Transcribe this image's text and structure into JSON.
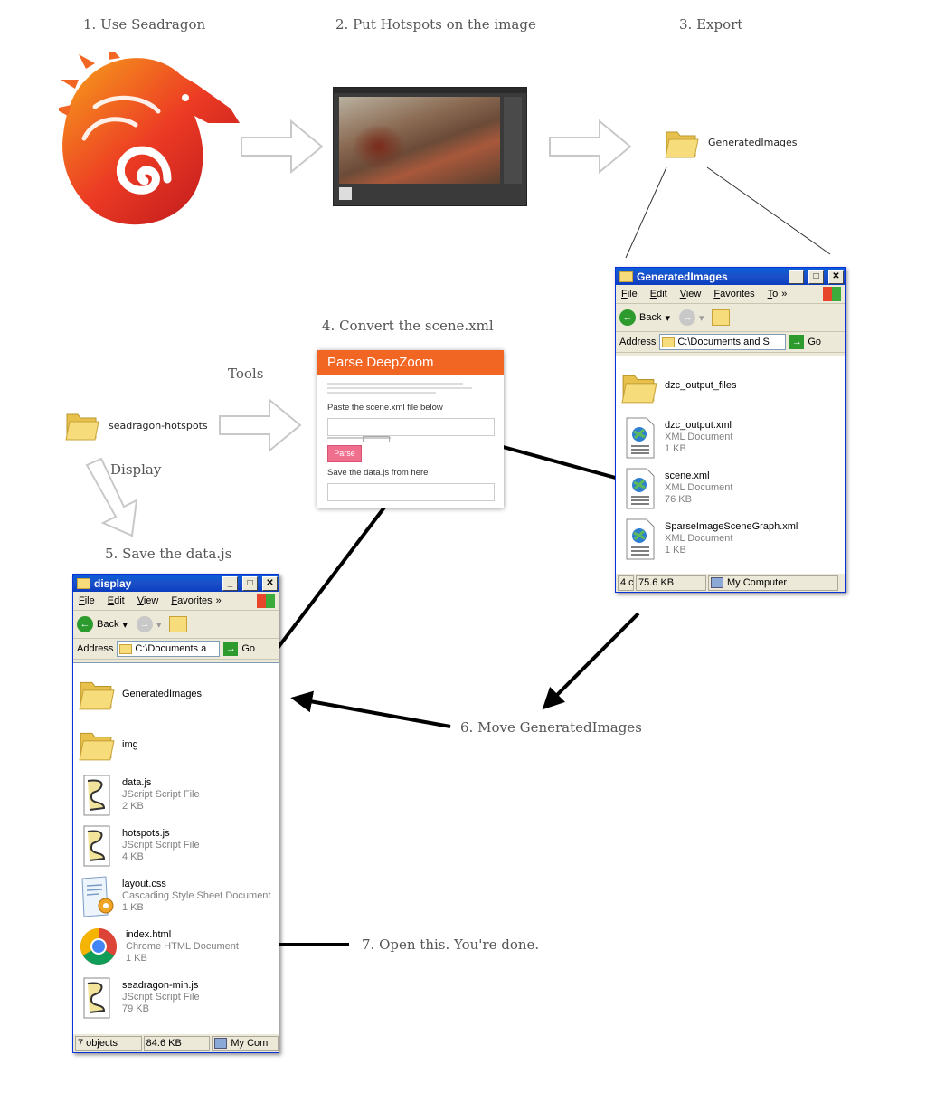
{
  "steps": {
    "s1": "1. Use Seadragon",
    "s2": "2. Put Hotspots on the image",
    "s3": "3. Export",
    "s4": "4. Convert the scene.xml",
    "s5": "5. Save the data.js",
    "s6": "6. Move GeneratedImages",
    "s7": "7. Open this. You're done."
  },
  "labels": {
    "generated_folder": "GeneratedImages",
    "hotspots_folder": "seadragon-hotspots",
    "tools": "Tools",
    "display": "Display"
  },
  "card": {
    "title": "Parse DeepZoom",
    "paste": "Paste the scene.xml file below",
    "parse_button": "Parse",
    "save": "Save the data.js from here"
  },
  "win_generated": {
    "title": "GeneratedImages",
    "menu": [
      "File",
      "Edit",
      "View",
      "Favorites",
      "To"
    ],
    "back": "Back",
    "address_label": "Address",
    "address_value": "C:\\Documents and S",
    "go": "Go",
    "files": [
      {
        "name": "dzc_output_files",
        "type": "",
        "size": "",
        "icon": "folder-icon"
      },
      {
        "name": "dzc_output.xml",
        "type": "XML Document",
        "size": "1 KB",
        "icon": "xml-document-icon"
      },
      {
        "name": "scene.xml",
        "type": "XML Document",
        "size": "76 KB",
        "icon": "xml-document-icon"
      },
      {
        "name": "SparseImageSceneGraph.xml",
        "type": "XML Document",
        "size": "1 KB",
        "icon": "xml-document-icon"
      }
    ],
    "status": [
      "4 c",
      "75.6 KB",
      "My Computer"
    ]
  },
  "win_display": {
    "title": "display",
    "menu": [
      "File",
      "Edit",
      "View",
      "Favorites"
    ],
    "back": "Back",
    "address_label": "Address",
    "address_value": "C:\\Documents a",
    "go": "Go",
    "files": [
      {
        "name": "GeneratedImages",
        "type": "",
        "size": "",
        "icon": "folder-icon"
      },
      {
        "name": "img",
        "type": "",
        "size": "",
        "icon": "folder-icon"
      },
      {
        "name": "data.js",
        "type": "JScript Script File",
        "size": "2 KB",
        "icon": "script-file-icon"
      },
      {
        "name": "hotspots.js",
        "type": "JScript Script File",
        "size": "4 KB",
        "icon": "script-file-icon"
      },
      {
        "name": "layout.css",
        "type": "Cascading Style Sheet Document",
        "size": "1 KB",
        "icon": "css-file-icon"
      },
      {
        "name": "index.html",
        "type": "Chrome HTML Document",
        "size": "1 KB",
        "icon": "chrome-icon"
      },
      {
        "name": "seadragon-min.js",
        "type": "JScript Script File",
        "size": "79 KB",
        "icon": "script-file-icon"
      }
    ],
    "status": [
      "7 objects",
      "84.6 KB",
      "My Com"
    ]
  },
  "colors": {
    "orange": "#f26624",
    "xp_blue": "#0a5fd8",
    "folder": "#f5d368"
  }
}
